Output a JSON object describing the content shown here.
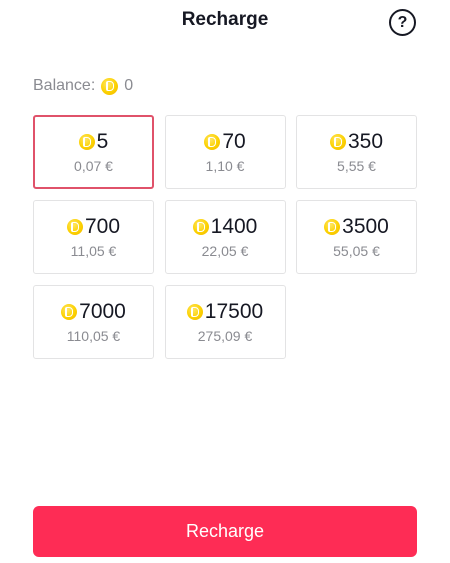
{
  "header": {
    "title": "Recharge",
    "help_icon": "question-circle-icon",
    "help_glyph": "?"
  },
  "balance": {
    "label": "Balance:",
    "icon": "coin-icon",
    "value": "0"
  },
  "packages": [
    {
      "coins": "5",
      "price": "0,07 €",
      "selected": true
    },
    {
      "coins": "70",
      "price": "1,10 €",
      "selected": false
    },
    {
      "coins": "350",
      "price": "5,55 €",
      "selected": false
    },
    {
      "coins": "700",
      "price": "11,05 €",
      "selected": false
    },
    {
      "coins": "1400",
      "price": "22,05 €",
      "selected": false
    },
    {
      "coins": "3500",
      "price": "55,05 €",
      "selected": false
    },
    {
      "coins": "7000",
      "price": "110,05 €",
      "selected": false
    },
    {
      "coins": "17500",
      "price": "275,09 €",
      "selected": false
    }
  ],
  "actions": {
    "recharge_label": "Recharge"
  },
  "colors": {
    "accent": "#fe2c55",
    "selected_border": "#e0526a",
    "coin": "#fcd100",
    "muted_text": "#8a8b91"
  }
}
